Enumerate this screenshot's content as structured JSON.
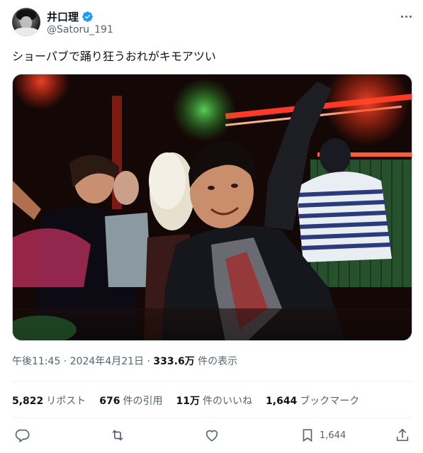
{
  "user": {
    "display_name": "井口理",
    "handle": "@Satoru_191",
    "verified_icon": "verified-badge-icon"
  },
  "tweet": {
    "text": "ショーパブで踊り狂うおれがキモアツい",
    "timestamp": "午後11:45 · 2024年4月21日 · ",
    "views_count": "333.6万",
    "views_label": " 件の表示"
  },
  "stats": {
    "reposts_count": "5,822",
    "reposts_label": "リポスト",
    "quotes_count": "676",
    "quotes_label": "件の引用",
    "likes_count": "11万",
    "likes_label": "件のいいね",
    "bookmarks_count": "1,644",
    "bookmarks_label": "ブックマーク"
  },
  "actions": {
    "reply_icon": "reply-icon",
    "repost_icon": "repost-icon",
    "like_icon": "heart-icon",
    "bookmark_icon": "bookmark-icon",
    "bookmark_count": "1,644",
    "share_icon": "share-icon"
  },
  "colors": {
    "verified_blue": "#1d9bf0",
    "secondary_text": "#536471",
    "primary_text": "#0f1419"
  }
}
